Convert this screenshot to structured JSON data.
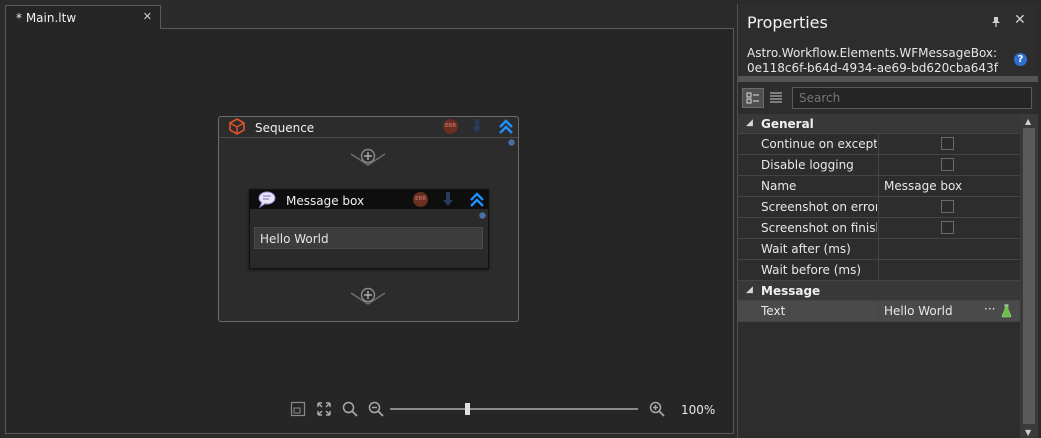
{
  "document_tab": {
    "label": "* Main.ltw",
    "close": "✕"
  },
  "workflow": {
    "sequence": {
      "title": "Sequence"
    },
    "message_box": {
      "title": "Message box",
      "text": "Hello World"
    }
  },
  "zoom": {
    "level": "100%",
    "slider_fraction": 0.31
  },
  "properties": {
    "title": "Properties",
    "object_type_line1": "Astro.Workflow.Elements.WFMessageBox:",
    "object_type_line2": "0e118c6f-b64d-4934-ae69-bd620cba643f",
    "search_placeholder": "Search",
    "categories": [
      {
        "label": "General",
        "rows": [
          {
            "name": "Continue on excepti...",
            "kind": "checkbox",
            "value": ""
          },
          {
            "name": "Disable logging",
            "kind": "checkbox",
            "value": ""
          },
          {
            "name": "Name",
            "kind": "text",
            "value": "Message box"
          },
          {
            "name": "Screenshot on error",
            "kind": "checkbox",
            "value": ""
          },
          {
            "name": "Screenshot on finish",
            "kind": "checkbox",
            "value": ""
          },
          {
            "name": "Wait after (ms)",
            "kind": "text",
            "value": ""
          },
          {
            "name": "Wait before (ms)",
            "kind": "text",
            "value": ""
          }
        ]
      },
      {
        "label": "Message",
        "rows": [
          {
            "name": "Text",
            "kind": "text",
            "value": "Hello World",
            "selected": true
          }
        ]
      }
    ],
    "more_button": "···"
  },
  "colors": {
    "accent_blue": "#1e90ff",
    "error_red": "#6a2e22",
    "flask_green": "#6cc04a"
  }
}
